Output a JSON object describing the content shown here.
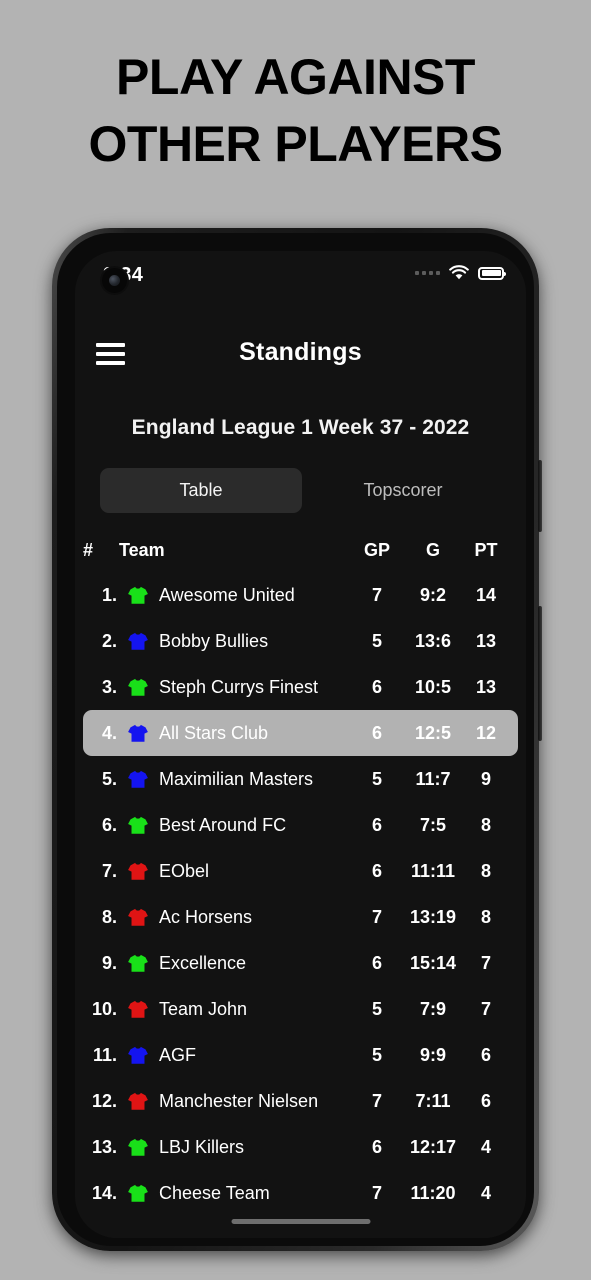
{
  "promo": {
    "line1": "PLAY AGAINST",
    "line2": "OTHER PLAYERS"
  },
  "statusbar": {
    "time": "9.34",
    "signal_icon": "signal-dots-icon",
    "wifi_icon": "wifi-icon",
    "battery_icon": "battery-full-icon",
    "battery_level": "100"
  },
  "appbar": {
    "menu_icon": "hamburger-menu-icon",
    "title": "Standings"
  },
  "league": {
    "title": "England League 1 Week 37 - 2022"
  },
  "tabs": [
    {
      "label": "Table",
      "active": true
    },
    {
      "label": "Topscorer",
      "active": false
    }
  ],
  "table": {
    "headers": {
      "rank": "#",
      "team": "Team",
      "gp": "GP",
      "g": "G",
      "pt": "PT"
    },
    "rows": [
      {
        "rank": "1.",
        "shirt": "green",
        "team": "Awesome United",
        "gp": "7",
        "g": "9:2",
        "pt": "14",
        "highlight": false
      },
      {
        "rank": "2.",
        "shirt": "blue",
        "team": "Bobby Bullies",
        "gp": "5",
        "g": "13:6",
        "pt": "13",
        "highlight": false
      },
      {
        "rank": "3.",
        "shirt": "green",
        "team": "Steph Currys Finest",
        "gp": "6",
        "g": "10:5",
        "pt": "13",
        "highlight": false
      },
      {
        "rank": "4.",
        "shirt": "blue",
        "team": "All Stars Club",
        "gp": "6",
        "g": "12:5",
        "pt": "12",
        "highlight": true
      },
      {
        "rank": "5.",
        "shirt": "blue",
        "team": "Maximilian Masters",
        "gp": "5",
        "g": "11:7",
        "pt": "9",
        "highlight": false
      },
      {
        "rank": "6.",
        "shirt": "green",
        "team": "Best Around FC",
        "gp": "6",
        "g": "7:5",
        "pt": "8",
        "highlight": false
      },
      {
        "rank": "7.",
        "shirt": "red",
        "team": "EObel",
        "gp": "6",
        "g": "11:11",
        "pt": "8",
        "highlight": false
      },
      {
        "rank": "8.",
        "shirt": "red",
        "team": "Ac Horsens",
        "gp": "7",
        "g": "13:19",
        "pt": "8",
        "highlight": false
      },
      {
        "rank": "9.",
        "shirt": "green",
        "team": "Excellence",
        "gp": "6",
        "g": "15:14",
        "pt": "7",
        "highlight": false
      },
      {
        "rank": "10.",
        "shirt": "red",
        "team": "Team John",
        "gp": "5",
        "g": "7:9",
        "pt": "7",
        "highlight": false
      },
      {
        "rank": "11.",
        "shirt": "blue",
        "team": "AGF",
        "gp": "5",
        "g": "9:9",
        "pt": "6",
        "highlight": false
      },
      {
        "rank": "12.",
        "shirt": "red",
        "team": "Manchester Nielsen",
        "gp": "7",
        "g": "7:11",
        "pt": "6",
        "highlight": false
      },
      {
        "rank": "13.",
        "shirt": "green",
        "team": "LBJ Killers",
        "gp": "6",
        "g": "12:17",
        "pt": "4",
        "highlight": false
      },
      {
        "rank": "14.",
        "shirt": "green",
        "team": "Cheese Team",
        "gp": "7",
        "g": "11:20",
        "pt": "4",
        "highlight": false
      }
    ]
  },
  "colors": {
    "page_background": "#b3b3b3",
    "screen_background": "#121212",
    "tab_active_background": "#2b2b2b",
    "row_highlight": "#b2b2b2",
    "shirt_green": "#19e019",
    "shirt_blue": "#1414f0",
    "shirt_red": "#e01414",
    "text_primary": "#ffffff"
  },
  "home_indicator": "home-indicator"
}
